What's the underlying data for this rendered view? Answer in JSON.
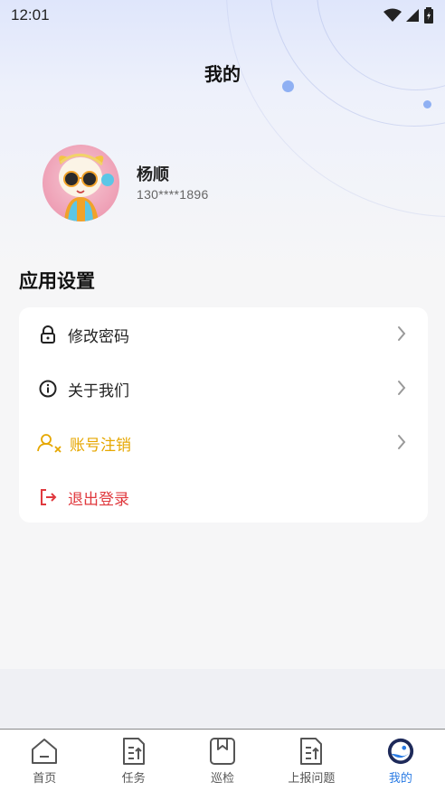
{
  "status_bar": {
    "time": "12:01"
  },
  "header": {
    "title": "我的"
  },
  "profile": {
    "name": "杨顺",
    "phone": "130****1896"
  },
  "settings": {
    "section_title": "应用设置",
    "items": [
      {
        "label": "修改密码",
        "icon": "lock-icon",
        "color": "#222222"
      },
      {
        "label": "关于我们",
        "icon": "info-icon",
        "color": "#222222"
      },
      {
        "label": "账号注销",
        "icon": "user-remove-icon",
        "color": "#e6a700"
      },
      {
        "label": "退出登录",
        "icon": "logout-icon",
        "color": "#e0393e"
      }
    ]
  },
  "tabbar": {
    "tabs": [
      {
        "label": "首页",
        "icon": "home-icon"
      },
      {
        "label": "任务",
        "icon": "task-document-icon"
      },
      {
        "label": "巡检",
        "icon": "inspection-book-icon"
      },
      {
        "label": "上报问题",
        "icon": "report-document-icon"
      },
      {
        "label": "我的",
        "icon": "profile-logo-icon"
      }
    ],
    "active_color": "#2a7be4"
  }
}
